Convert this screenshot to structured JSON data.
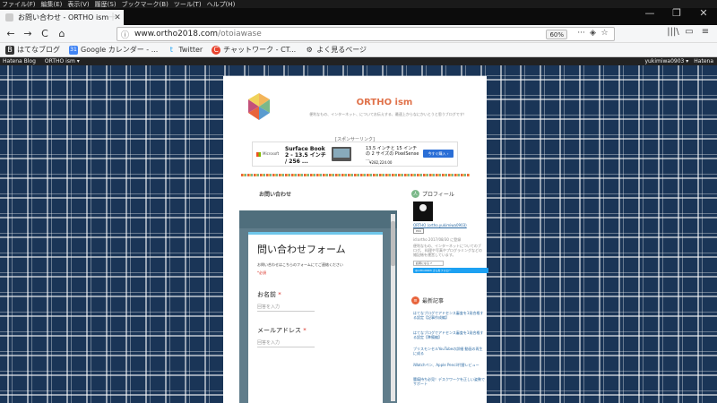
{
  "menu": [
    "ファイル(F)",
    "編集(E)",
    "表示(V)",
    "履歴(S)",
    "ブックマーク(B)",
    "ツール(T)",
    "ヘルプ(H)"
  ],
  "window_controls": {
    "minimize": "—",
    "maximize": "❐",
    "close": "✕"
  },
  "tab": {
    "title": "お問い合わせ - ORTHO ism",
    "close": "✕",
    "new_tab": "+"
  },
  "nav": {
    "back": "←",
    "forward": "→",
    "reload": "C",
    "home": "⌂"
  },
  "url": {
    "info": "ⓘ",
    "host": "www.ortho2018.com",
    "path": "/otoiawase",
    "zoom": "60%"
  },
  "url_icons": {
    "menu": "···",
    "pocket": "◈",
    "star": "☆"
  },
  "toolbar_right": {
    "library": "|||\\",
    "sidebar": "▭",
    "menu": "≡"
  },
  "bookmarks": [
    {
      "label": "はてなブログ",
      "icon": "B"
    },
    {
      "label": "Google カレンダー - ...",
      "icon": "31"
    },
    {
      "label": "Twitter",
      "icon": "t"
    },
    {
      "label": "チャットワーク - CT...",
      "icon": "C"
    },
    {
      "label": "よく見るページ",
      "icon": "⚙"
    }
  ],
  "hatena_bar": {
    "logo": "Hatena Blog",
    "mid": "ORTHO ism ▾",
    "user": "yukimiwa0903 ▾",
    "brand": "Hatena"
  },
  "blog": {
    "title": "ORTHO ism",
    "description": "便利なもの、インターネット、についてお伝えする、最速上からなにかいとうと思うブログです！"
  },
  "ad": {
    "sponsor_label": "[スポンサーリンク]",
    "brand": "Microsoft",
    "product1": "Surface Book 2 - 13.5 インチ / 256 ...",
    "product2": "13.5 インチと 15 インチの 2 サイズの PixelSense ...",
    "price": "¥282,224.00",
    "cta": "今すぐ購入 ›"
  },
  "page_heading": "お問い合わせ",
  "form": {
    "title": "問い合わせフォーム",
    "description": "お問い合わせはこちらのフォームにてご連絡ください",
    "required_note": "*必須",
    "fields": [
      {
        "label": "お名前",
        "required": "*",
        "placeholder": "回答を入力"
      },
      {
        "label": "メールアドレス",
        "required": "*",
        "placeholder": "回答を入力"
      }
    ]
  },
  "sidebar": {
    "profile_heading": "プロフィール",
    "profile_icon": "人",
    "user_link": "ORTHO (ortho.yukimiwa0903)",
    "pro_badge": "PRO",
    "reader_count": "id:ortho 2017/08/30 に登録",
    "bio": "便利なもの、インターネットについてのブログ。 料理や写真やプログラミングなどの 雑記帳を運営しています。",
    "reader_button": "読者になる  7",
    "twitter_button": "@ortho0903 さんをフォロー",
    "recent_heading": "最新記事",
    "recent_icon": "≡",
    "recent_articles": [
      "はてなブログでアドセンス審査を1発合格する設定【記事作成編】",
      "はてなブログでアドセンス審査を1発合格する設定【準備編】",
      "ブリスモンセルYouTubeの詳細 動画の再生に成る",
      "iWatchペン、Apple Pencil代替レビュー",
      "腰痛持ち必見！デスクワークを正しい姿勢でサポート"
    ]
  },
  "colors": {
    "accent": "#e0724a",
    "plaid": "#1a3557",
    "form_header": "#607d8b",
    "link": "#2e6ca4"
  }
}
